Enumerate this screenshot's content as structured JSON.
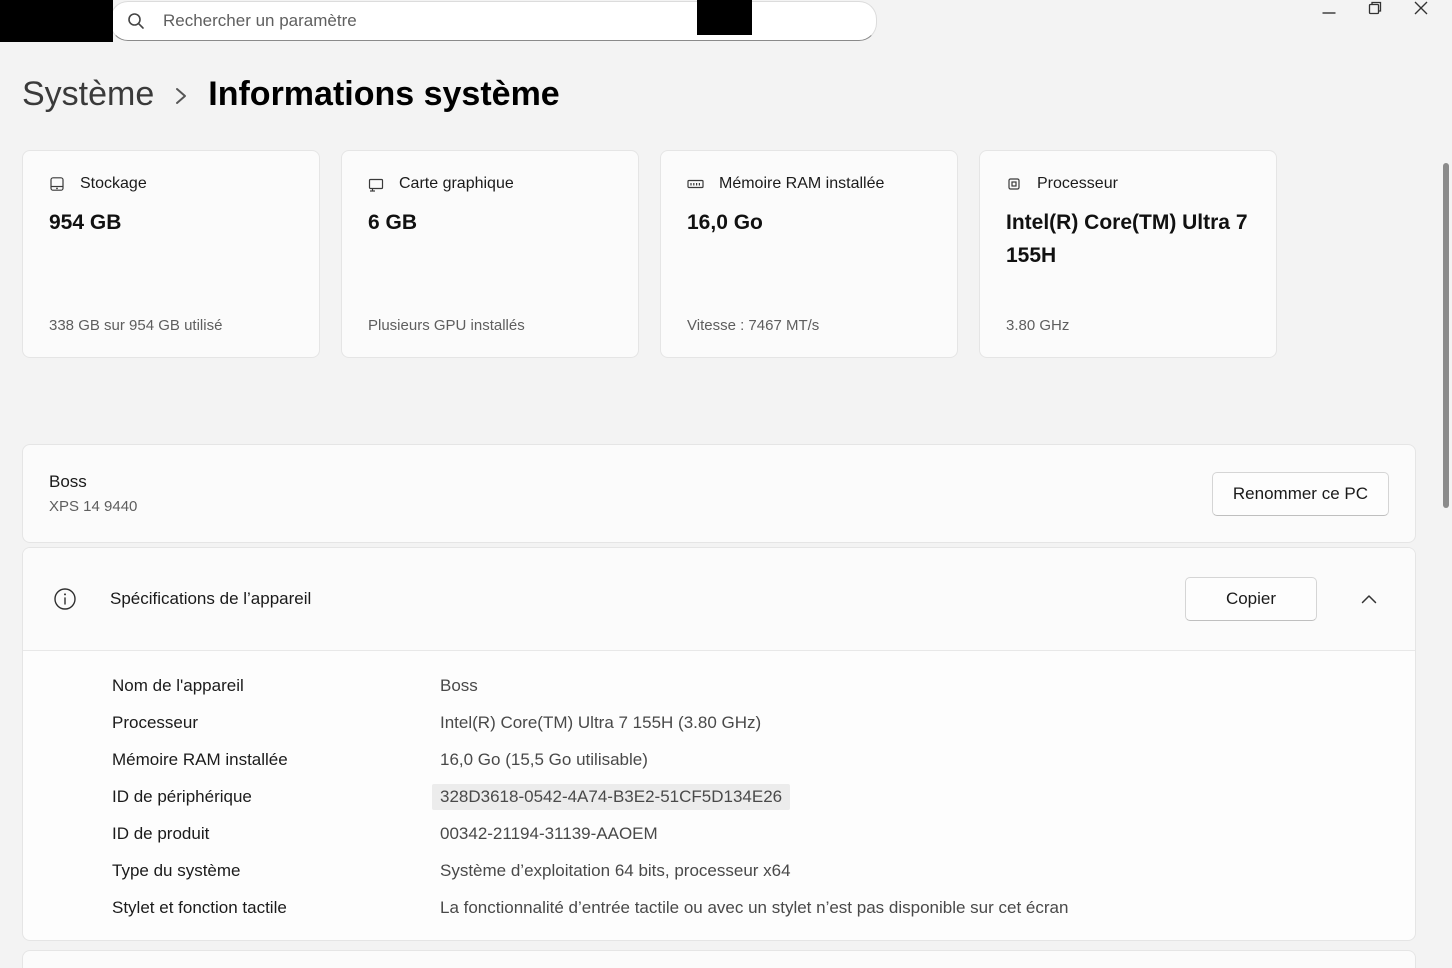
{
  "search": {
    "placeholder": "Rechercher un paramètre"
  },
  "breadcrumb": {
    "parent": "Système",
    "current": "Informations système"
  },
  "accent_colors": {
    "background": "#f3f3f3",
    "card": "#fbfbfb",
    "border": "#e5e5e5"
  },
  "cards": [
    {
      "icon": "storage-icon",
      "title": "Stockage",
      "value": "954 GB",
      "subtitle": "338 GB sur 954 GB utilisé"
    },
    {
      "icon": "gpu-icon",
      "title": "Carte graphique",
      "value": "6 GB",
      "subtitle": "Plusieurs GPU installés"
    },
    {
      "icon": "ram-icon",
      "title": "Mémoire RAM installée",
      "value": "16,0 Go",
      "subtitle": "Vitesse : 7467 MT/s"
    },
    {
      "icon": "cpu-icon",
      "title": "Processeur",
      "value": "Intel(R) Core(TM) Ultra 7 155H",
      "subtitle": "3.80 GHz"
    }
  ],
  "device": {
    "name": "Boss",
    "model": "XPS 14 9440",
    "rename_button": "Renommer ce PC"
  },
  "specs": {
    "icon": "info-icon",
    "title": "Spécifications de l’appareil",
    "copy_button": "Copier",
    "rows": [
      {
        "label": "Nom de l'appareil",
        "value": "Boss"
      },
      {
        "label": "Processeur",
        "value": "Intel(R) Core(TM) Ultra 7 155H (3.80 GHz)"
      },
      {
        "label": "Mémoire RAM installée",
        "value": "16,0 Go (15,5 Go utilisable)"
      },
      {
        "label": "ID de périphérique",
        "value": "328D3618-0542-4A74-B3E2-51CF5D134E26"
      },
      {
        "label": "ID de produit",
        "value": "00342-21194-31139-AAOEM"
      },
      {
        "label": "Type du système",
        "value": "Système d’exploitation 64 bits, processeur x64"
      },
      {
        "label": "Stylet et fonction tactile",
        "value": "La fonctionnalité d’entrée tactile ou avec un stylet n’est pas disponible sur cet écran"
      }
    ]
  }
}
